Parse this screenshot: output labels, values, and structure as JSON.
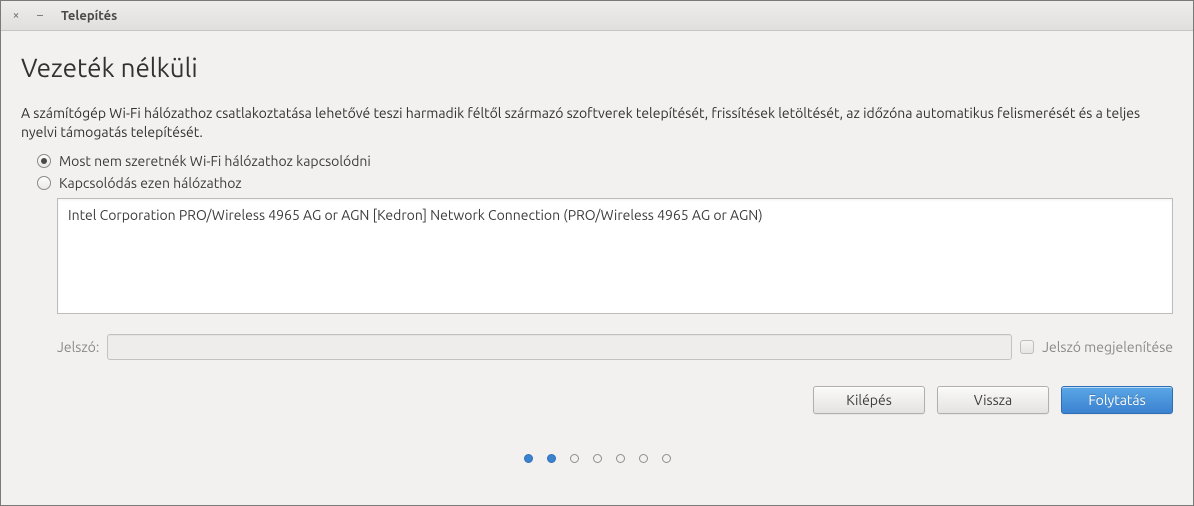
{
  "window": {
    "title": "Telepítés"
  },
  "page": {
    "heading": "Vezeték nélküli",
    "description": "A számítógép Wi-Fi hálózathoz csatlakoztatása lehetővé teszi harmadik féltől származó szoftverek telepítését, frissítések letöltését, az időzóna automatikus felismerését és a teljes nyelvi támogatás telepítését."
  },
  "options": {
    "no_connect_label": "Most nem szeretnék Wi-Fi hálózathoz kapcsolódni",
    "connect_label": "Kapcsolódás ezen hálózathoz",
    "selected": "no_connect"
  },
  "networks": [
    "Intel Corporation PRO/Wireless 4965 AG or AGN [Kedron] Network Connection (PRO/Wireless 4965 AG or AGN)"
  ],
  "password": {
    "label": "Jelszó:",
    "value": "",
    "show_label": "Jelszó megjelenítése",
    "show_checked": false
  },
  "buttons": {
    "quit": "Kilépés",
    "back": "Vissza",
    "continue": "Folytatás"
  },
  "progress": {
    "total": 7,
    "current": 2
  }
}
